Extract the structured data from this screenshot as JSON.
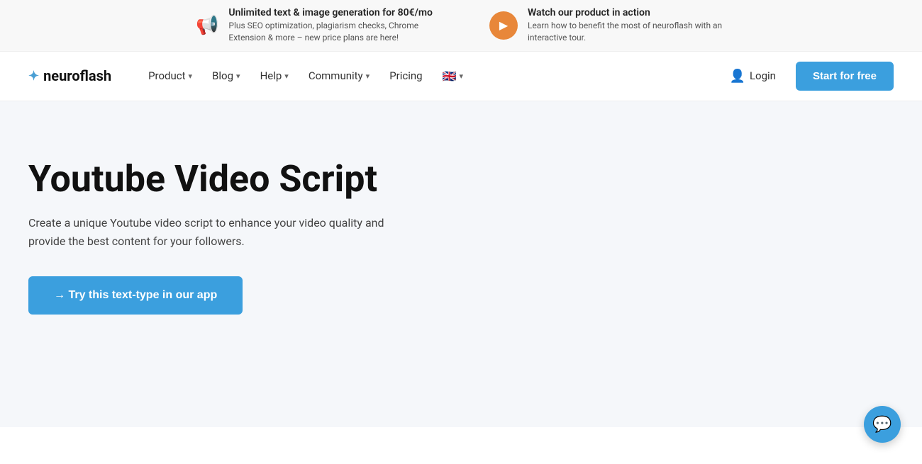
{
  "banner": {
    "item1": {
      "title": "Unlimited text & image generation for 80€/mo",
      "subtitle": "Plus SEO optimization, plagiarism checks, Chrome Extension & more – new price plans are here!"
    },
    "item2": {
      "title": "Watch our product in action",
      "subtitle": "Learn how to benefit the most of neuroflash with an interactive tour."
    }
  },
  "nav": {
    "logo_text": "neuroflash",
    "items": [
      {
        "label": "Product",
        "has_dropdown": true
      },
      {
        "label": "Blog",
        "has_dropdown": true
      },
      {
        "label": "Help",
        "has_dropdown": true
      },
      {
        "label": "Community",
        "has_dropdown": true
      },
      {
        "label": "Pricing",
        "has_dropdown": false
      }
    ],
    "login_label": "Login",
    "start_label": "Start for free"
  },
  "hero": {
    "title": "Youtube Video Script",
    "subtitle": "Create a unique Youtube video script to enhance your video quality and provide the best content for your followers.",
    "cta_label": "→ Try this text-type in our app"
  },
  "chat": {
    "icon": "💬"
  }
}
